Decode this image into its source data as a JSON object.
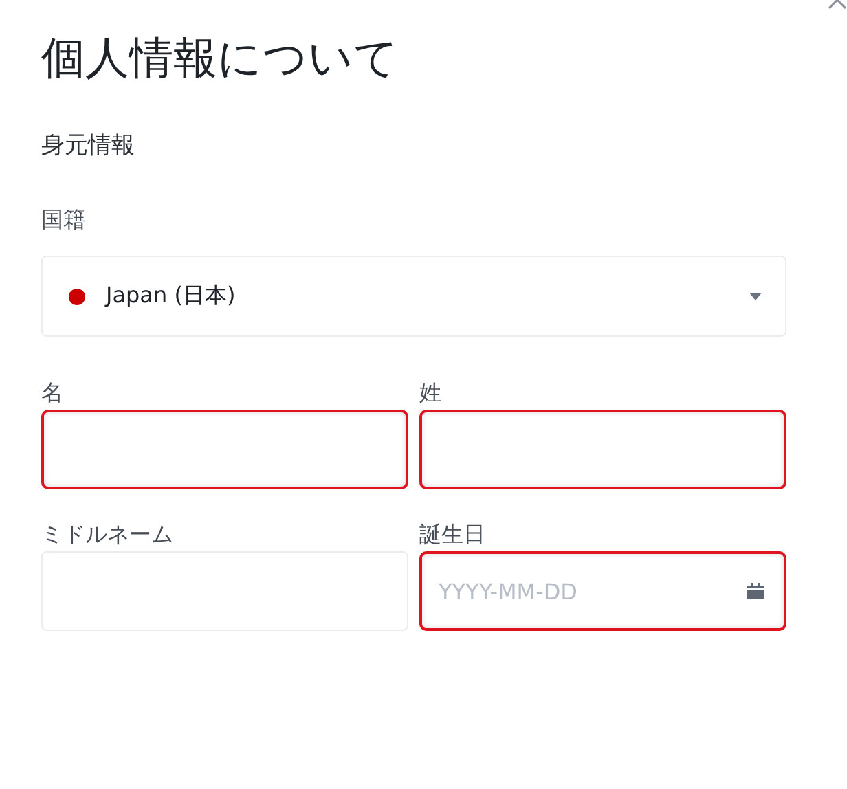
{
  "title": "個人情報について",
  "section": "身元情報",
  "nationality": {
    "label": "国籍",
    "value": "Japan (日本)",
    "color": "#cc0000"
  },
  "fields": [
    {
      "label": "名",
      "kind": "text",
      "error": true
    },
    {
      "label": "姓",
      "kind": "text",
      "error": true
    },
    {
      "label": "ミドルネーム",
      "kind": "text",
      "error": false
    },
    {
      "label": "誕生日",
      "kind": "date",
      "placeholder": "YYYY-MM-DD",
      "error": true
    }
  ]
}
